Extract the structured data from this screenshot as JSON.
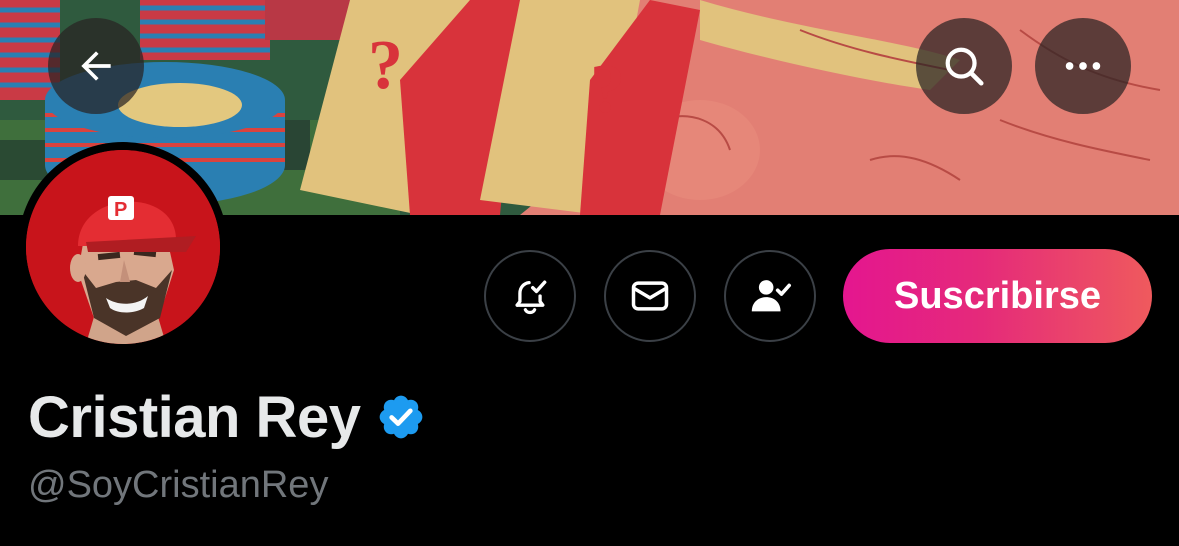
{
  "header": {
    "back_icon": "arrow-left-icon",
    "search_icon": "search-icon",
    "more_icon": "more-horizontal-icon"
  },
  "profile": {
    "display_name": "Cristian Rey",
    "handle": "@SoyCristianRey",
    "verified": true,
    "verified_color": "#1d9bf0"
  },
  "actions": {
    "notifications_icon": "bell-check-icon",
    "message_icon": "envelope-icon",
    "following_icon": "person-check-icon",
    "subscribe_label": "Suscribirse"
  },
  "colors": {
    "background": "#000000",
    "subscribe_gradient_start": "#e4168f",
    "subscribe_gradient_end": "#ef5a5d",
    "name_color": "#e7e9ea",
    "handle_color": "#71767b"
  }
}
